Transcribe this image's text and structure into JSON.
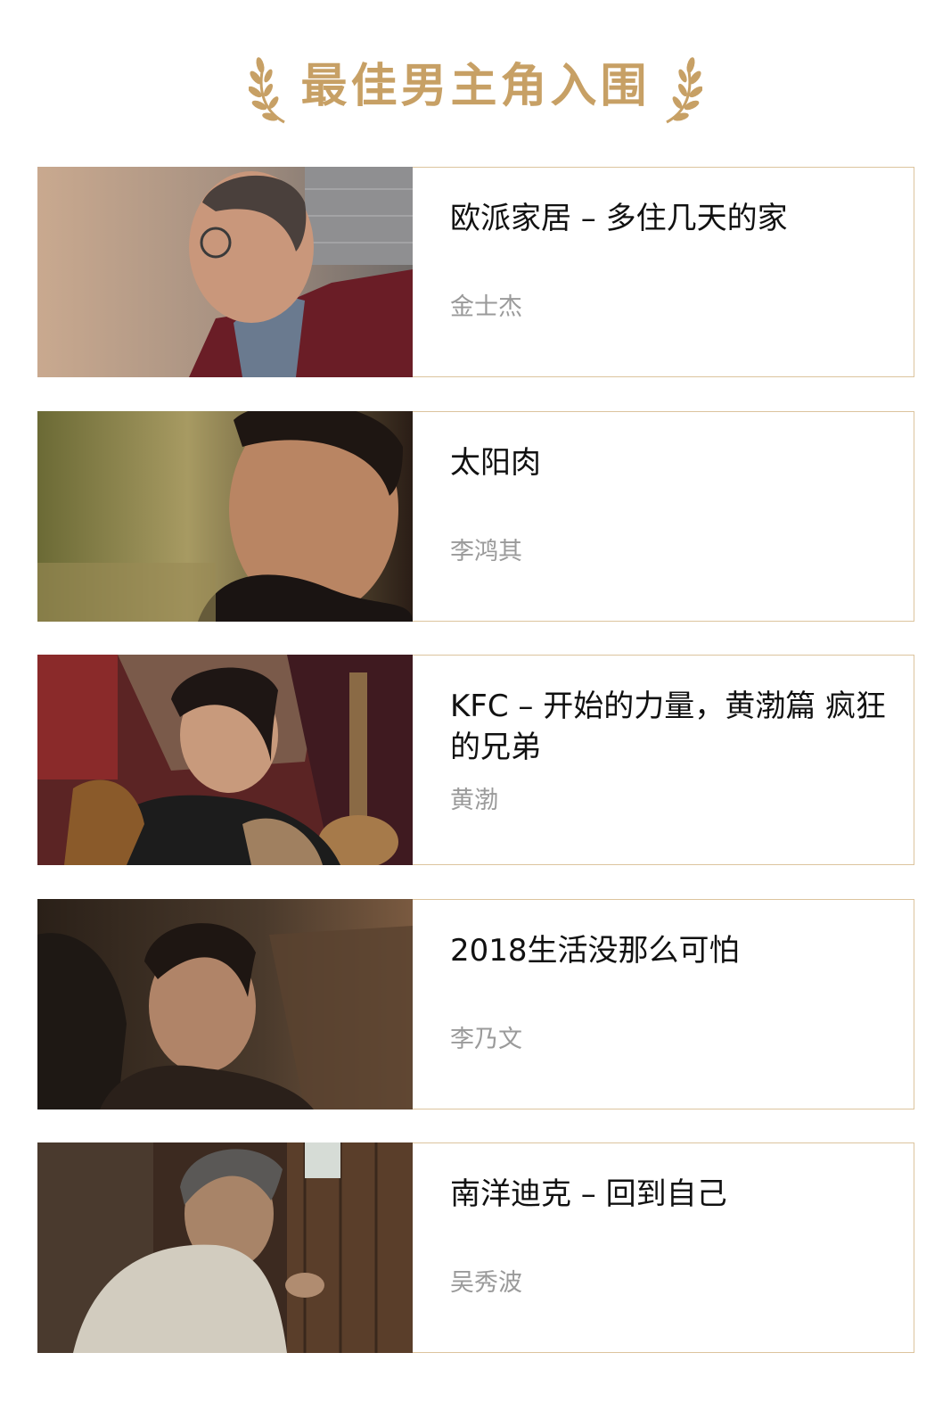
{
  "header": {
    "title": "最佳男主角入围",
    "accent_color": "#c7a065"
  },
  "nominees": [
    {
      "title": "欧派家居 – 多住几天的家",
      "actor": "金士杰",
      "thumbnail": "elderly-man-glasses-red-vest"
    },
    {
      "title": "太阳肉",
      "actor": "李鸿其",
      "thumbnail": "young-man-closeup-dark"
    },
    {
      "title": "KFC  –  开始的力量，黄渤篇 疯狂的兄弟",
      "actor": "黄渤",
      "thumbnail": "man-leather-jacket-guitar"
    },
    {
      "title": "2018生活没那么可怕",
      "actor": "李乃文",
      "thumbnail": "man-in-car-driver-seat"
    },
    {
      "title": "南洋迪克 – 回到自己",
      "actor": "吴秀波",
      "thumbnail": "gray-haired-man-sweater"
    }
  ]
}
